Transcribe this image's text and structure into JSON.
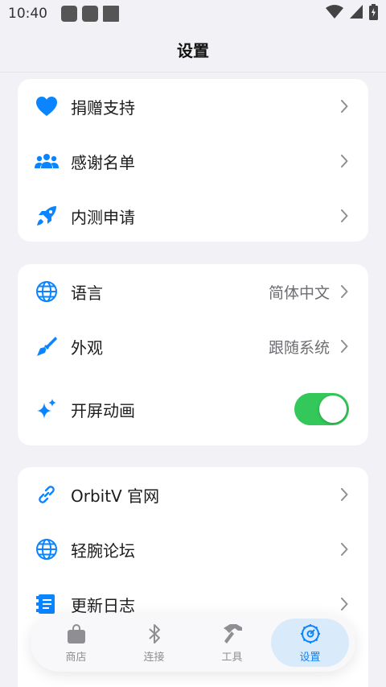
{
  "status_bar": {
    "time": "10:40"
  },
  "nav": {
    "title": "设置"
  },
  "sections": {
    "support": {
      "donate": {
        "label": "捐赠支持",
        "icon": "heart-icon"
      },
      "thanks": {
        "label": "感谢名单",
        "icon": "people-icon"
      },
      "beta": {
        "label": "内测申请",
        "icon": "rocket-icon"
      }
    },
    "preferences": {
      "language": {
        "label": "语言",
        "value": "简体中文",
        "icon": "globe-icon"
      },
      "appearance": {
        "label": "外观",
        "value": "跟随系统",
        "icon": "paintbrush-icon"
      },
      "splash": {
        "label": "开屏动画",
        "icon": "sparkles-icon",
        "enabled": true
      }
    },
    "links": {
      "website": {
        "label": "OrbitV 官网",
        "icon": "link-icon"
      },
      "forum": {
        "label": "轻腕论坛",
        "icon": "globe-icon"
      },
      "changelog": {
        "label": "更新日志",
        "icon": "document-icon"
      }
    }
  },
  "tab_bar": {
    "tabs": [
      {
        "label": "商店",
        "icon": "bag-icon",
        "active": false
      },
      {
        "label": "连接",
        "icon": "bluetooth-icon",
        "active": false
      },
      {
        "label": "工具",
        "icon": "hammer-icon",
        "active": false
      },
      {
        "label": "设置",
        "icon": "gear-icon",
        "active": true
      }
    ]
  },
  "colors": {
    "accent": "#0a84ff",
    "toggle_on": "#34c759",
    "background": "#f2f2f6",
    "card": "#ffffff"
  }
}
